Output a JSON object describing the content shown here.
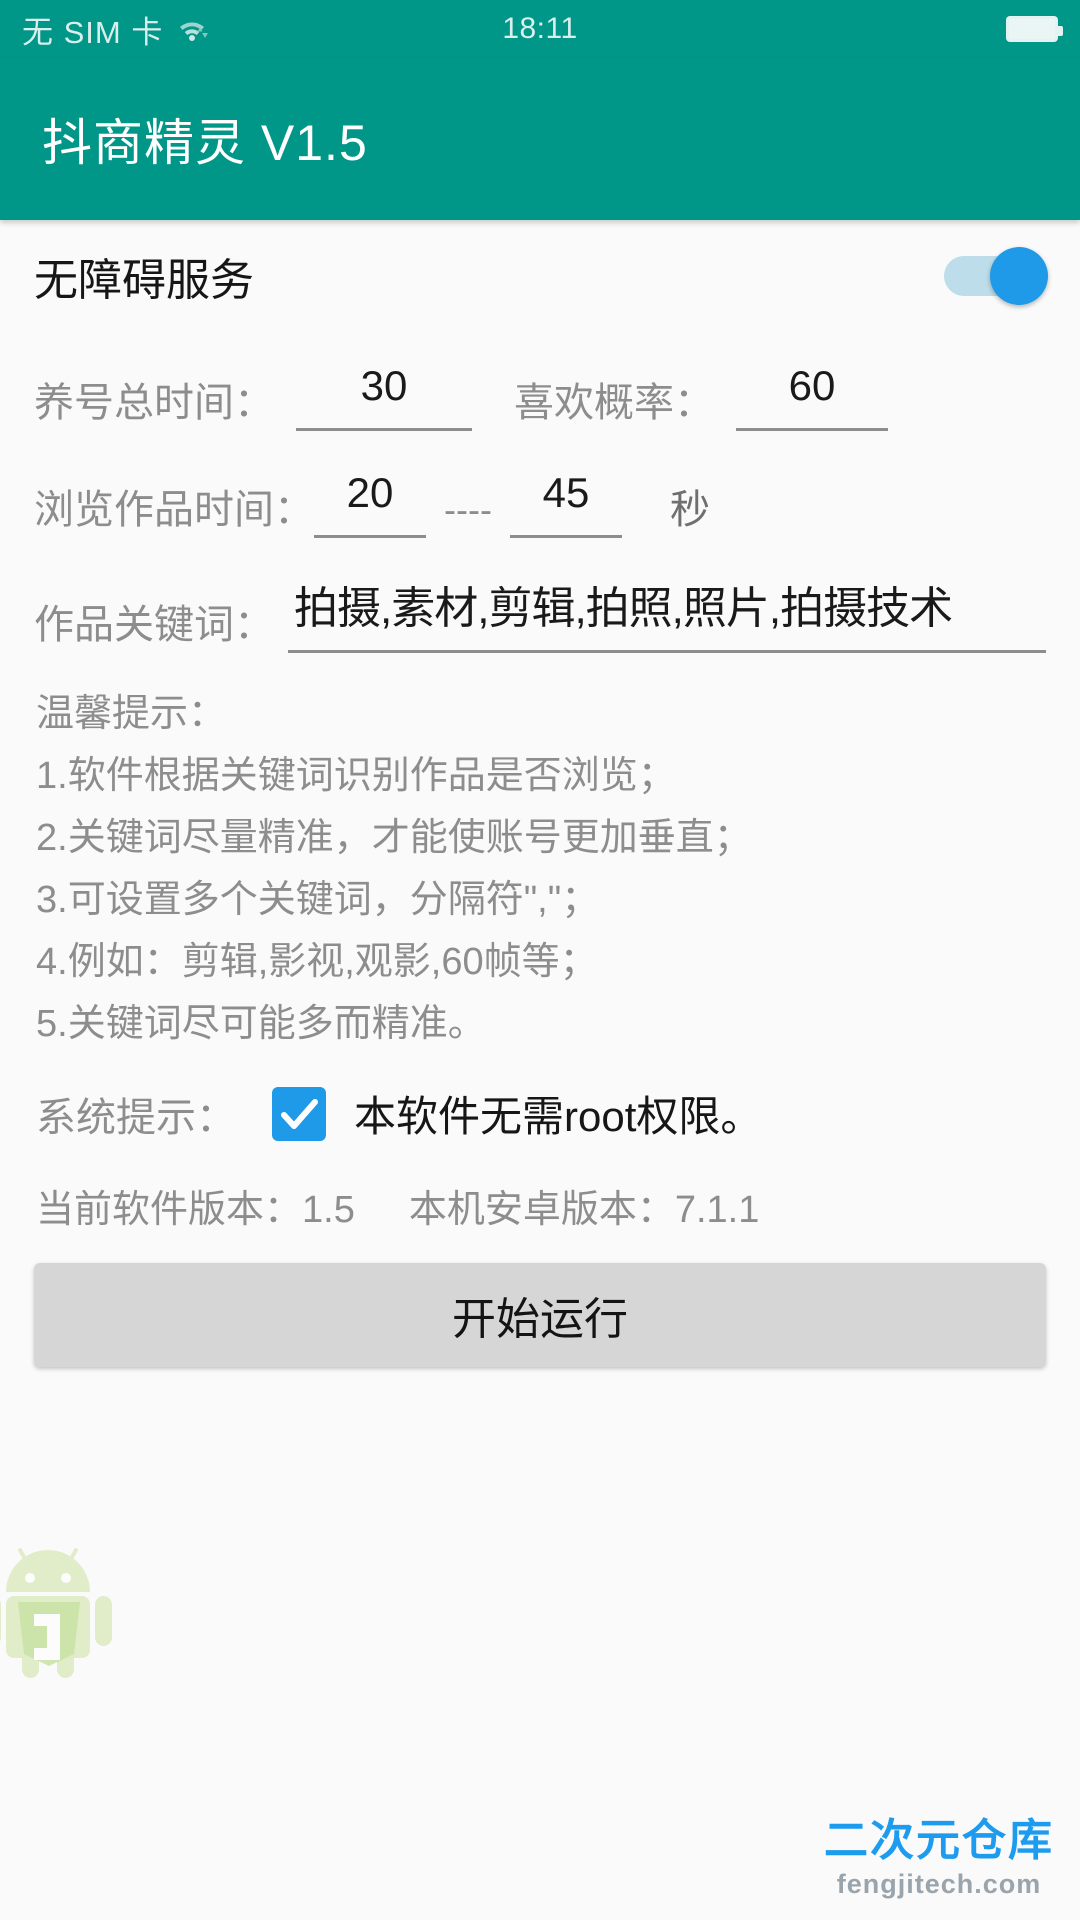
{
  "status_bar": {
    "sim_text": "无 SIM 卡",
    "wifi_icon": "wifi-icon",
    "time": "18:11",
    "battery_icon": "battery-icon"
  },
  "app_bar": {
    "title": "抖商精灵 V1.5"
  },
  "service": {
    "label": "无障碍服务",
    "toggle_state": "on",
    "toggle_color": "#1e9ae8",
    "track_color": "#bcdde9"
  },
  "fields": {
    "total_time": {
      "label": "养号总时间：",
      "value": "30"
    },
    "like_rate": {
      "label": "喜欢概率：",
      "value": "60"
    },
    "browse_time": {
      "label": "浏览作品时间：",
      "min": "20",
      "separator": "----",
      "max": "45",
      "unit": "秒"
    },
    "keywords": {
      "label": "作品关键词：",
      "value": "拍摄,素材,剪辑,拍照,照片,拍摄技术"
    }
  },
  "tips": {
    "title": "温馨提示：",
    "lines": [
      "1.软件根据关键词识别作品是否浏览；",
      "2.关键词尽量精准，才能使账号更加垂直；",
      "3.可设置多个关键词，分隔符\",\"；",
      "4.例如：剪辑,影视,观影,60帧等；",
      "5.关键词尽可能多而精准。"
    ]
  },
  "system_hint": {
    "label": "系统提示：",
    "checked": true,
    "checkbox_color": "#1e9ae8",
    "text": "本软件无需root权限。"
  },
  "version": {
    "app_label": "当前软件版本：1.5",
    "android_label": "本机安卓版本：7.1.1"
  },
  "run_button": {
    "label": "开始运行"
  },
  "decorations": {
    "android_logo": "android-robot-icon",
    "watermark_main": "二次元仓库",
    "watermark_sub": "fengjitech.com"
  },
  "colors": {
    "primary": "#009688",
    "accent": "#1e9ae8",
    "page_bg": "#fafafa",
    "button_bg": "#d6d6d6"
  }
}
